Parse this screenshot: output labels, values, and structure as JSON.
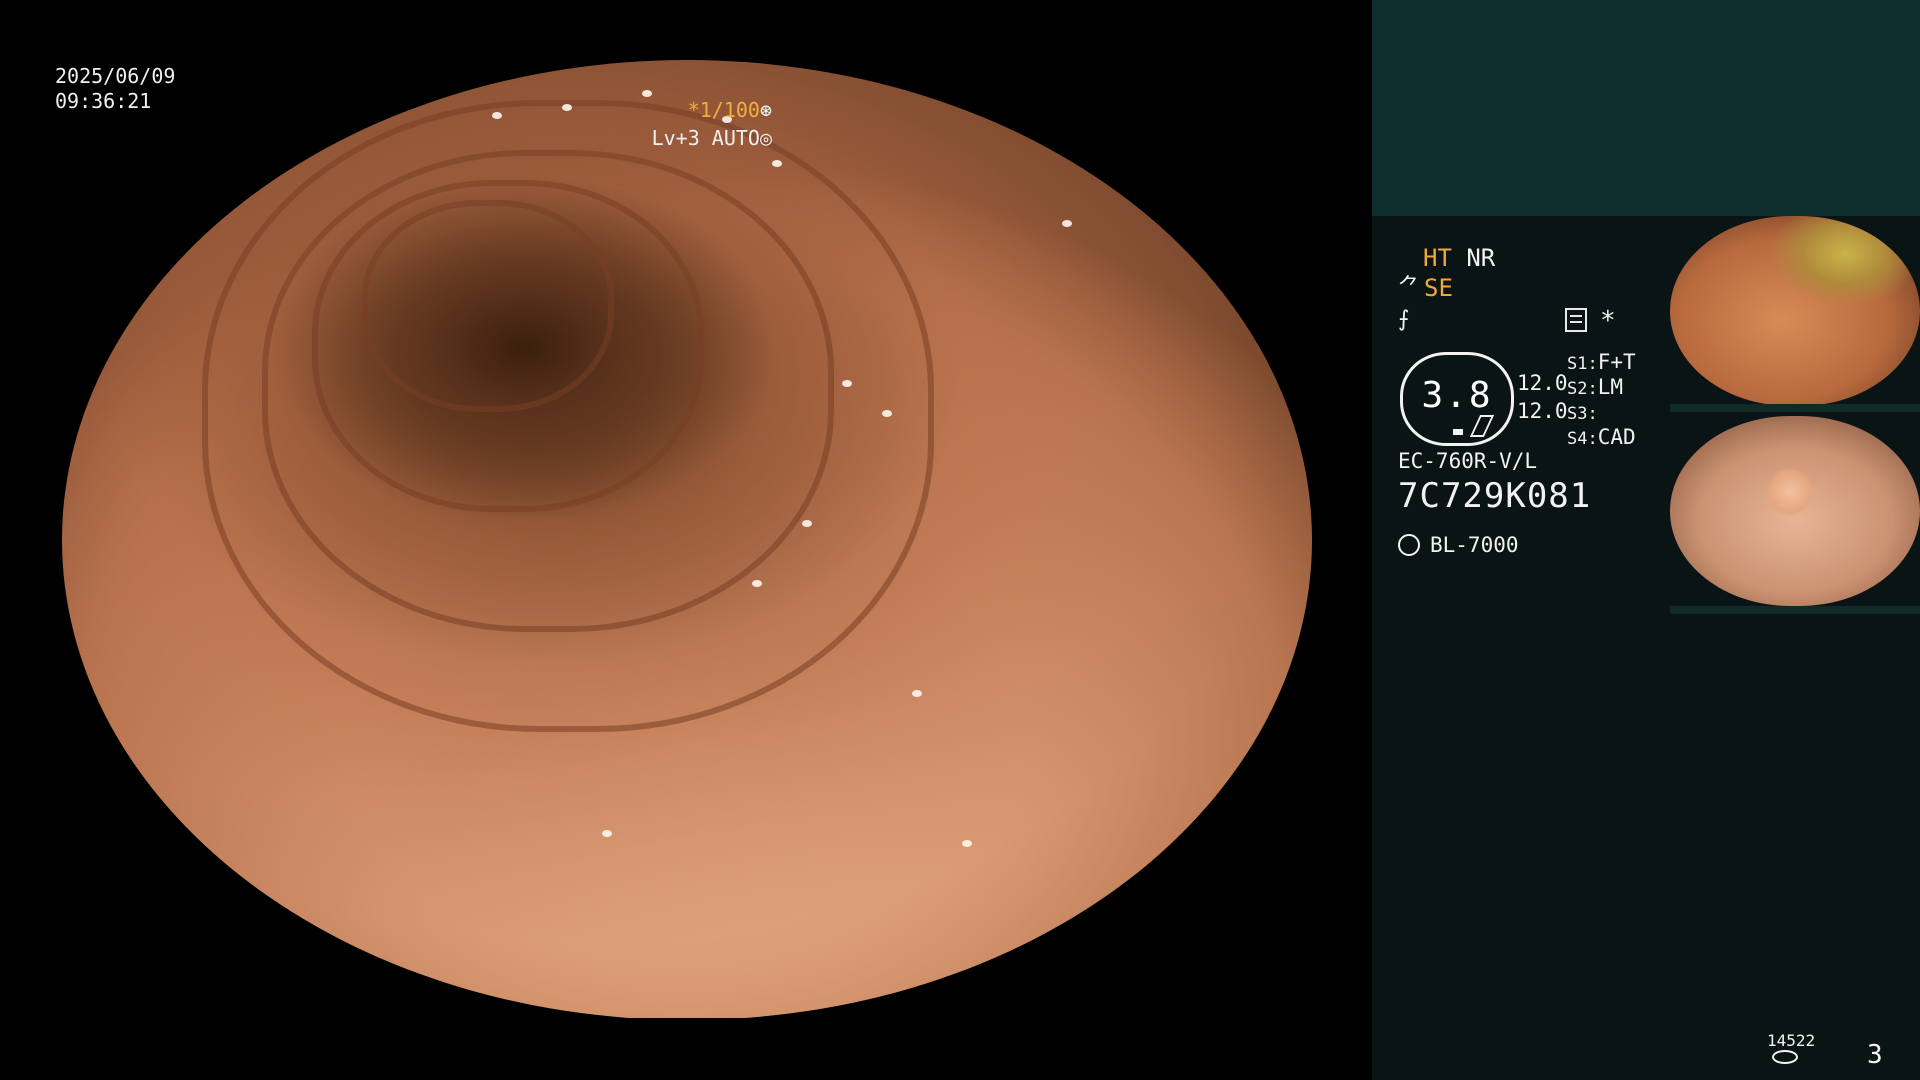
{
  "video": {
    "date": "2025/06/09",
    "time": "09:36:21",
    "shutter_prefix": "*1/100",
    "shutter_icon": "aperture-icon",
    "level": "Lv+3 AUTO",
    "level_icon": "auto-exposure-icon"
  },
  "panel": {
    "ht": "HT",
    "nr": "NR",
    "se": "SE",
    "se_icon": "scope-enhance-icon",
    "flat_icon": "flat-mode-icon",
    "settings_icon": "settings-list-icon",
    "asterisk": "*",
    "dial_value": "3.8",
    "value_1": "12.0",
    "value_2": "12.0",
    "slots": [
      {
        "key": "S1:",
        "value": "F+T"
      },
      {
        "key": "S2:",
        "value": "LM"
      },
      {
        "key": "S3:",
        "value": ""
      },
      {
        "key": "S4:",
        "value": "CAD"
      }
    ],
    "scope_model": "EC-760R-V/L",
    "serial": "7C729K081",
    "light_source": "BL-7000",
    "light_icon": "light-source-icon",
    "counter": "14522",
    "counter_icon": "storage-disk-icon",
    "page_number": "3"
  },
  "colors": {
    "accent": "#f0a838",
    "panel_bg": "#0b1414",
    "panel_top": "#0e2d2d"
  }
}
